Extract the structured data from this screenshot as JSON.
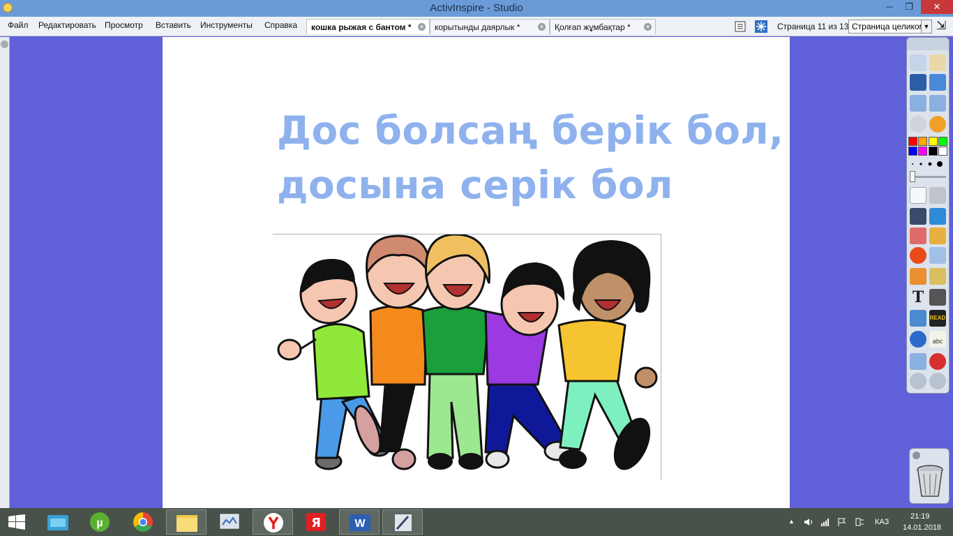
{
  "window": {
    "title": "ActivInspire - Studio",
    "minimize_glyph": "─",
    "maximize_glyph": "❐",
    "close_glyph": "✕"
  },
  "menu": [
    "Файл",
    "Редактировать",
    "Просмотр",
    "Вставить",
    "Инструменты",
    "Справка"
  ],
  "tabs": [
    {
      "label": "кошка рыжая с бантом *",
      "active": true
    },
    {
      "label": "корытынды даярлык *",
      "active": false
    },
    {
      "label": "Қолғап жұмбақтар *",
      "active": false
    }
  ],
  "pager": {
    "page_label": "Страница 11 из 13",
    "zoom_value": "Страница целиком",
    "zoom_arrow": "▼",
    "expand_glyph": "⇲"
  },
  "page": {
    "heading": "Дос болсаң берік бол,\nдосына серік бол"
  },
  "toolbox": {
    "colors": [
      "#ff0000",
      "#ffa500",
      "#ffff00",
      "#00ff00",
      "#0000ff",
      "#ff00ff",
      "#000000",
      "#ffffff"
    ],
    "tool_text": "T",
    "read_badge": "READ",
    "abc_badge": "abc"
  },
  "tray": {
    "language": "КАЗ",
    "time": "21:19",
    "date": "14.01.2018",
    "up_arrow": "▲"
  },
  "colors": {
    "desktop": "#6060d8",
    "heading": "#8fb2ee",
    "titlebar": "#6a9bd8"
  }
}
